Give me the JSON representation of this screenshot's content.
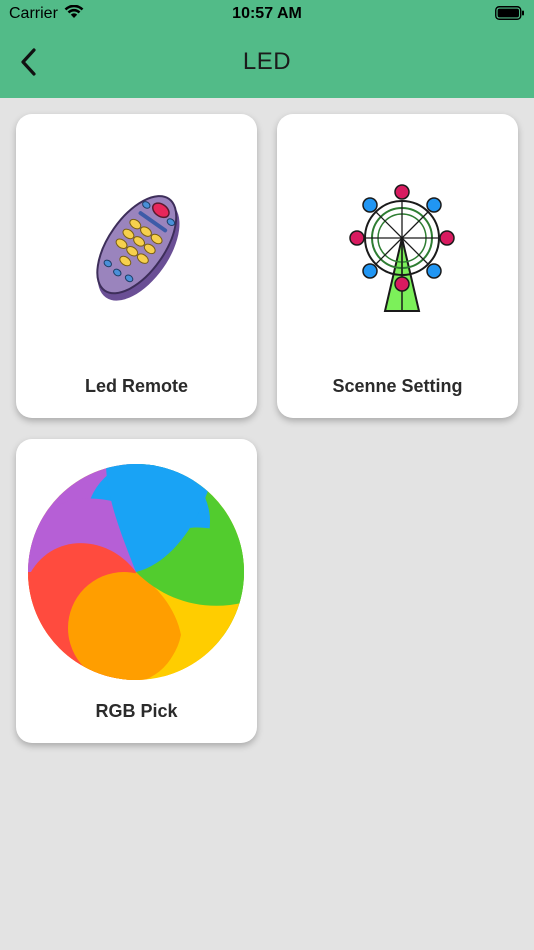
{
  "status_bar": {
    "carrier": "Carrier",
    "time": "10:57 AM"
  },
  "nav": {
    "title": "LED",
    "back_icon": "chevron-left-icon"
  },
  "colors": {
    "header_bg": "#52bb88",
    "page_bg": "#e3e3e3",
    "card_bg": "#ffffff"
  },
  "cards": [
    {
      "label": "Led Remote",
      "icon": "remote-control-icon"
    },
    {
      "label": "Scenne Setting",
      "icon": "ferris-wheel-icon"
    },
    {
      "label": "RGB Pick",
      "icon": "color-wheel-icon"
    }
  ]
}
